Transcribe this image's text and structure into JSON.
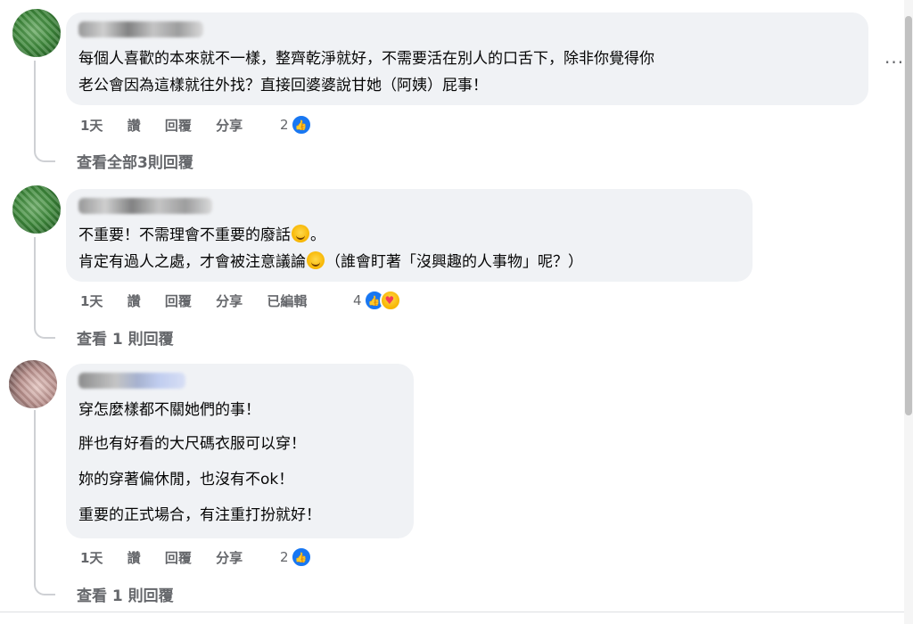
{
  "comments": [
    {
      "lines": [
        "每個人喜歡的本來就不一樣，整齊乾淨就好，不需要活在別人的口舌下，除非你覺得你",
        "老公會因為這樣就往外找？直接回婆婆說甘她（阿姨）屁事！"
      ],
      "time": "1天",
      "like_label": "讚",
      "reply_label": "回覆",
      "share_label": "分享",
      "reaction_count": "2",
      "view_replies": "查看全部3則回覆"
    },
    {
      "line1_text": "不重要！不需理會不重要的廢話",
      "line1_suffix": "。",
      "line2_text": "肯定有過人之處，才會被注意議論",
      "line2_suffix": "（誰會盯著「沒興趣的人事物」呢？）",
      "time": "1天",
      "like_label": "讚",
      "reply_label": "回覆",
      "share_label": "分享",
      "edited_label": "已編輯",
      "reaction_count": "4",
      "view_replies": "查看 1 則回覆"
    },
    {
      "lines": [
        "穿怎麼樣都不關她們的事！",
        "胖也有好看的大尺碼衣服可以穿！",
        "妳的穿著偏休閒，也沒有不ok！",
        "重要的正式場合，有注重打扮就好！"
      ],
      "time": "1天",
      "like_label": "讚",
      "reply_label": "回覆",
      "share_label": "分享",
      "reaction_count": "2",
      "view_replies": "查看 1 則回覆"
    }
  ],
  "icons": {
    "like": "like-thumb-icon",
    "care": "care-reaction-icon",
    "more": "more-options-icon"
  },
  "colors": {
    "bubble": "#f0f2f5",
    "meta_text": "#65676b",
    "like_blue": "#1877f2"
  }
}
